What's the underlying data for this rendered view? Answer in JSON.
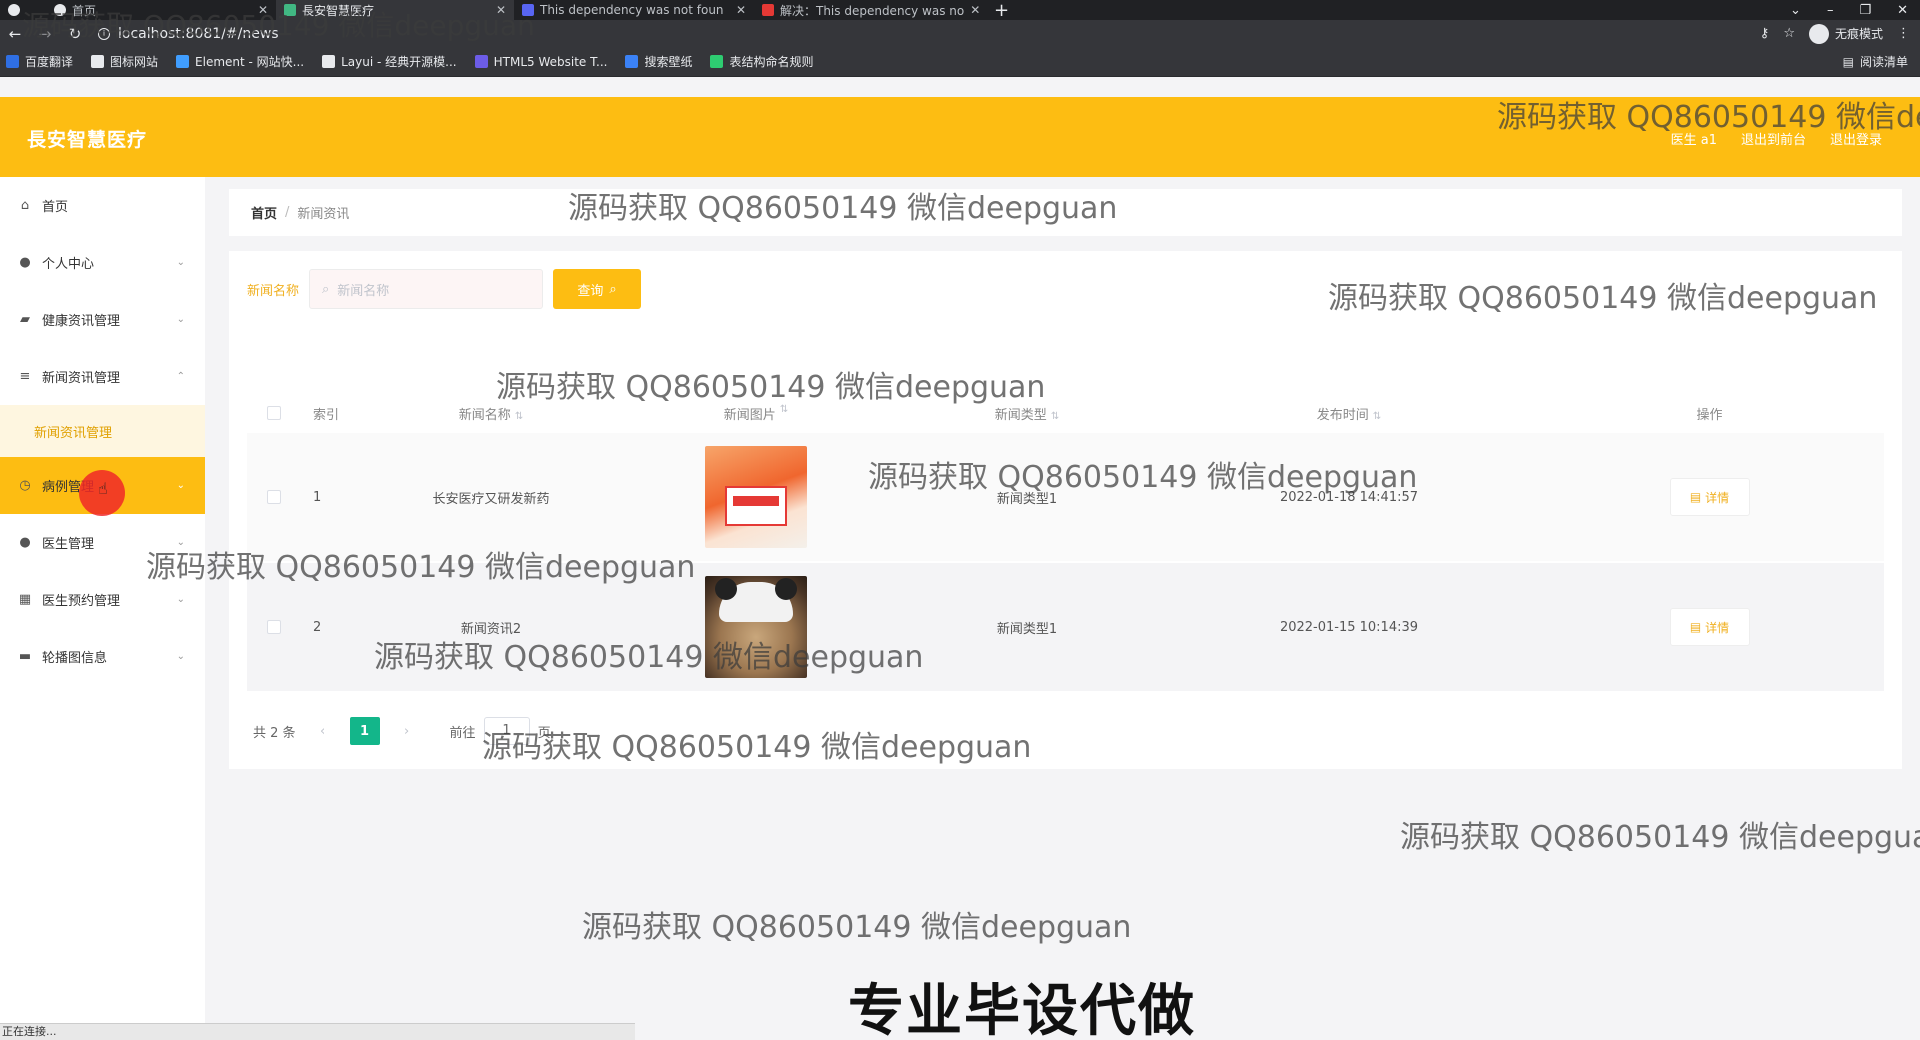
{
  "browser": {
    "tabs": [
      {
        "label": "首页",
        "favicon_color": "#e8eaed"
      },
      {
        "label": "長安智慧医疗",
        "favicon_color": "#41b883"
      },
      {
        "label": "This dependency was not foun",
        "favicon_color": "#5865f2"
      },
      {
        "label": "解决：This dependency was no",
        "favicon_color": "#e53935"
      }
    ],
    "new_tab": "+",
    "window_controls": [
      "⌄",
      "–",
      "❐",
      "✕"
    ],
    "url": "localhost:8081/#/news",
    "incognito_label": "无痕模式",
    "bookmarks": [
      {
        "label": "百度翻译",
        "color": "#2f6fe4"
      },
      {
        "label": "图标网站",
        "color": "#e8eaed"
      },
      {
        "label": "Element - 网站快...",
        "color": "#409eff"
      },
      {
        "label": "Layui - 经典开源模...",
        "color": "#e8eaed"
      },
      {
        "label": "HTML5 Website T...",
        "color": "#6c5ce7"
      },
      {
        "label": "搜索壁纸",
        "color": "#3b82f6"
      },
      {
        "label": "表结构命名规则",
        "color": "#2ecc71"
      }
    ],
    "reading_list": "阅读清单"
  },
  "header": {
    "logo": "長安智慧医疗",
    "user": "医生 a1",
    "to_front": "退出到前台",
    "logout": "退出登录",
    "accent": "#fdbd12"
  },
  "sidebar": {
    "items": [
      {
        "label": "首页",
        "icon": "home-icon",
        "glyph": "⌂"
      },
      {
        "label": "个人中心",
        "icon": "user-icon",
        "glyph": "👤"
      },
      {
        "label": "健康资讯管理",
        "icon": "briefcase-icon",
        "glyph": "▰"
      },
      {
        "label": "新闻资讯管理",
        "icon": "list-icon",
        "glyph": "≡"
      },
      {
        "label": "病例管理",
        "icon": "clock-icon",
        "glyph": "◷"
      },
      {
        "label": "医生管理",
        "icon": "user-icon",
        "glyph": "👤"
      },
      {
        "label": "医生预约管理",
        "icon": "grid-icon",
        "glyph": "▦"
      },
      {
        "label": "轮播图信息",
        "icon": "image-icon",
        "glyph": "▬"
      }
    ],
    "sub_item": "新闻资讯管理"
  },
  "breadcrumb": {
    "home": "首页",
    "separator": "/",
    "current": "新闻资讯"
  },
  "search": {
    "label": "新闻名称",
    "placeholder": "新闻名称",
    "button": "查询"
  },
  "table": {
    "columns": [
      "索引",
      "新闻名称",
      "新闻图片",
      "新闻类型",
      "发布时间",
      "操作"
    ],
    "rows": [
      {
        "index": "1",
        "name": "长安医疗又研发新药",
        "type": "新闻类型1",
        "time": "2022-01-18 14:41:57",
        "action": "详情"
      },
      {
        "index": "2",
        "name": "新闻资讯2",
        "type": "新闻类型1",
        "time": "2022-01-15 10:14:39",
        "action": "详情"
      }
    ]
  },
  "pagination": {
    "total": "共 2 条",
    "current_page": "1",
    "goto_prefix": "前往",
    "goto_value": "1",
    "goto_suffix": "页",
    "accent": "#13b68a"
  },
  "watermark": "源码获取 QQ86050149 微信deepguan",
  "watermark_partial_top": "源码获取 QQ86050149 微信deepguan",
  "watermark_partial_right": "源码获取 QQ86050149 微信de",
  "watermark_partial_right2": "源码获取 QQ86050149 微信deepgua",
  "caption": "专业毕设代做",
  "status": "正在连接..."
}
